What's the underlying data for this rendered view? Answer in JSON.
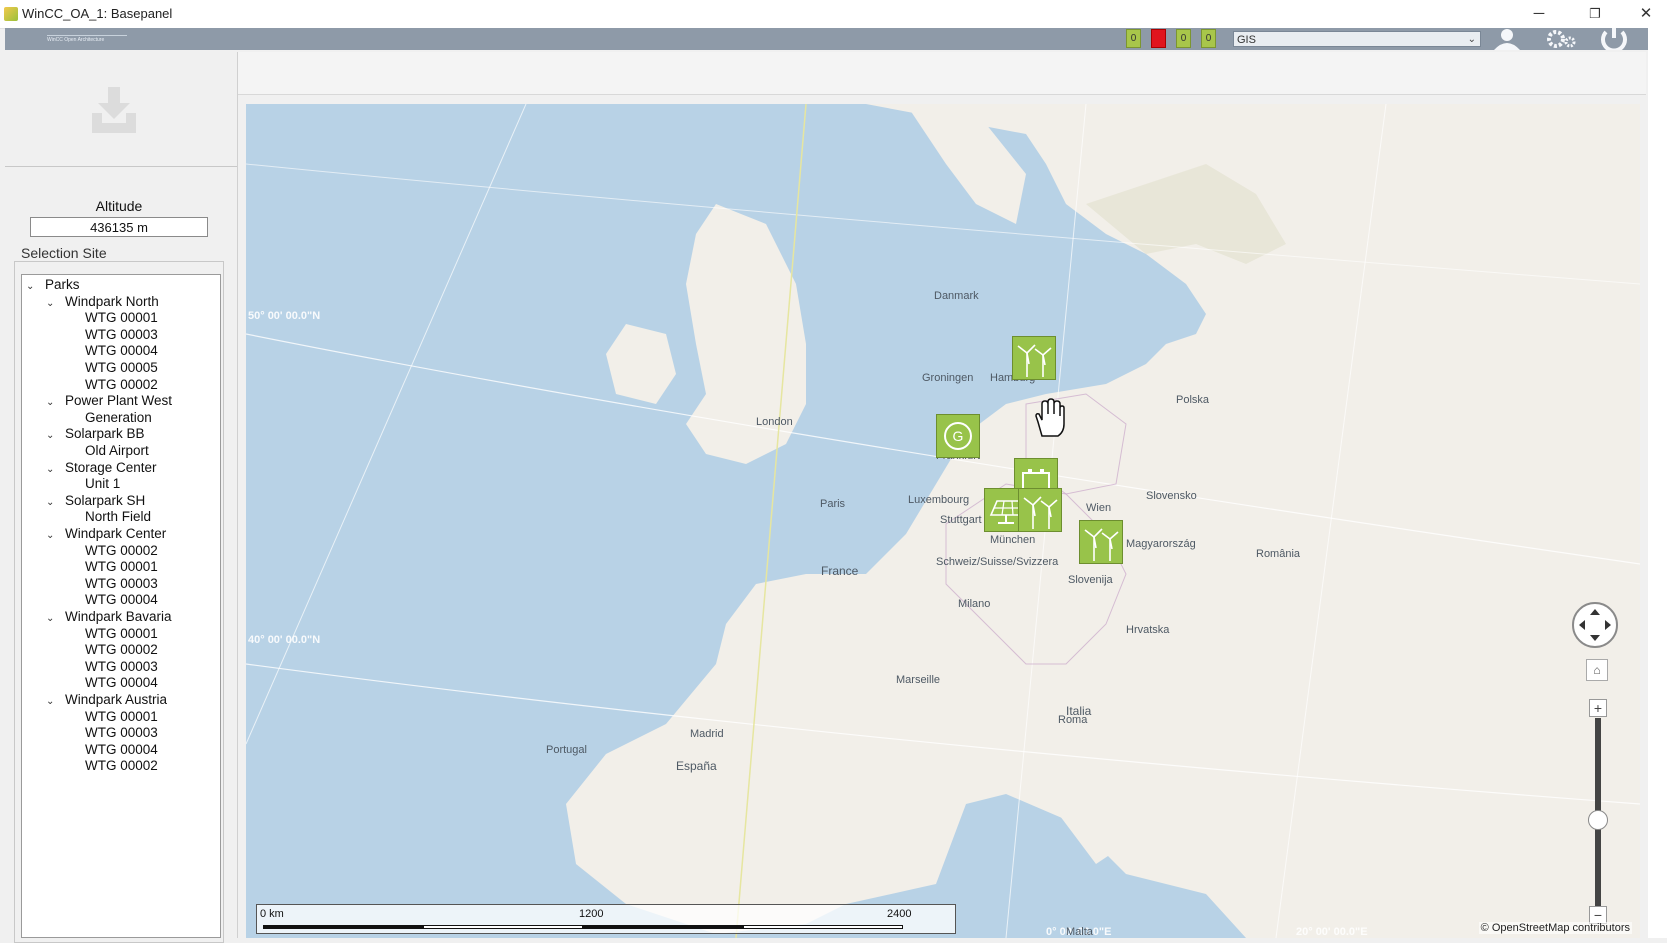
{
  "window": {
    "title": "WinCC_OA_1: Basepanel",
    "minimize": "─",
    "restore": "❐",
    "close": "✕"
  },
  "header": {
    "logo_text": "WinCC Open Architecture",
    "indicators": [
      "0",
      "0",
      "0",
      "0"
    ],
    "indicator_colors": [
      "#a8c64a",
      "#e0141e",
      "#a8c64a",
      "#a8c64a"
    ],
    "view_select": "GIS",
    "icons": [
      "user-icon",
      "settings-icon",
      "power-icon"
    ]
  },
  "sidebar": {
    "import_icon": "download-tray-icon",
    "altitude_label": "Altitude",
    "altitude_value": "436135 m",
    "selection_title": "Selection Site",
    "tree": [
      {
        "label": "Parks",
        "level": 0,
        "expanded": true
      },
      {
        "label": "Windpark North",
        "level": 1,
        "expanded": true
      },
      {
        "label": "WTG 00001",
        "level": 2
      },
      {
        "label": "WTG 00003",
        "level": 2
      },
      {
        "label": "WTG 00004",
        "level": 2
      },
      {
        "label": "WTG 00005",
        "level": 2
      },
      {
        "label": "WTG 00002",
        "level": 2
      },
      {
        "label": "Power Plant West",
        "level": 1,
        "expanded": true
      },
      {
        "label": "Generation",
        "level": 2
      },
      {
        "label": "Solarpark BB",
        "level": 1,
        "expanded": true
      },
      {
        "label": "Old Airport",
        "level": 2
      },
      {
        "label": "Storage Center",
        "level": 1,
        "expanded": true
      },
      {
        "label": "Unit 1",
        "level": 2
      },
      {
        "label": "Solarpark SH",
        "level": 1,
        "expanded": true
      },
      {
        "label": "North Field",
        "level": 2
      },
      {
        "label": "Windpark Center",
        "level": 1,
        "expanded": true
      },
      {
        "label": "WTG 00002",
        "level": 2
      },
      {
        "label": "WTG 00001",
        "level": 2
      },
      {
        "label": "WTG 00003",
        "level": 2
      },
      {
        "label": "WTG 00004",
        "level": 2
      },
      {
        "label": "Windpark Bavaria",
        "level": 1,
        "expanded": true
      },
      {
        "label": "WTG 00001",
        "level": 2
      },
      {
        "label": "WTG 00002",
        "level": 2
      },
      {
        "label": "WTG 00003",
        "level": 2
      },
      {
        "label": "WTG 00004",
        "level": 2
      },
      {
        "label": "Windpark Austria",
        "level": 1,
        "expanded": true
      },
      {
        "label": "WTG 00001",
        "level": 2
      },
      {
        "label": "WTG 00003",
        "level": 2
      },
      {
        "label": "WTG 00004",
        "level": 2
      },
      {
        "label": "WTG 00002",
        "level": 2
      }
    ]
  },
  "map": {
    "markers": [
      {
        "name": "windpark-north-marker",
        "icon": "wind-turbine-icon"
      },
      {
        "name": "power-plant-west-marker",
        "icon": "generator-icon",
        "label": "G"
      },
      {
        "name": "storage-center-marker",
        "icon": "battery-icon"
      },
      {
        "name": "solarpark-marker",
        "icon": "solar-panel-icon"
      },
      {
        "name": "windpark-center-marker",
        "icon": "wind-turbine-icon"
      },
      {
        "name": "windpark-austria-marker",
        "icon": "wind-turbine-icon"
      }
    ],
    "labels": {
      "lat50": "50° 00' 00.0\"N",
      "lat40": "40° 00' 00.0\"N",
      "lon0": "0° 00' 00.0\"E",
      "lon20": "20° 00' 00.0\"E",
      "france": "France",
      "espana": "España",
      "italia": "Italia",
      "london": "London",
      "frankfurt": "Frankfurt",
      "muenchen": "München",
      "hamburg": "Hamburg",
      "milano": "Milano",
      "paris": "Paris",
      "madrid": "Madrid",
      "roma": "Roma",
      "stuttgart": "Stuttgart",
      "wien": "Wien",
      "polska": "Polska",
      "slovensko": "Slovensko",
      "magyarorszag": "Magyarország",
      "romania": "România",
      "danmark": "Danmark",
      "portugal": "Portugal",
      "marseille": "Marseille",
      "malta": "Malta",
      "groningen": "Groningen",
      "luxembourg": "Luxembourg",
      "schweiz": "Schweiz/Suisse/Svizzera",
      "slovenija": "Slovenija",
      "hrvatska": "Hrvatska"
    },
    "scale": {
      "start": "0 km",
      "mid": "1200",
      "end": "2400"
    },
    "attribution": "© OpenStreetMap contributors",
    "zoom_in": "+",
    "zoom_out": "−",
    "home_icon": "home-icon"
  }
}
